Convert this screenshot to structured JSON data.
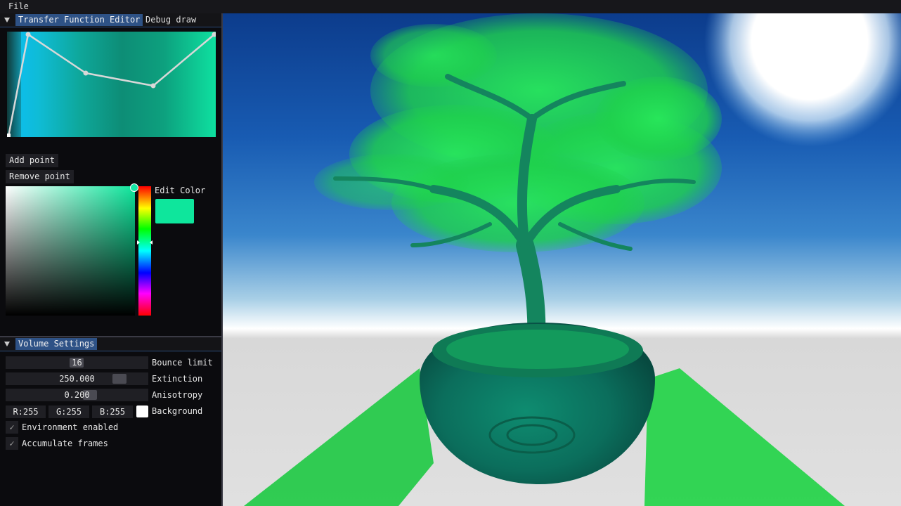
{
  "menubar": {
    "file_label": "File"
  },
  "tabs": [
    {
      "label": "Transfer Function Editor",
      "active": true
    },
    {
      "label": "Debug draw",
      "active": false
    }
  ],
  "transfer_function": {
    "add_point_label": "Add point",
    "remove_point_label": "Remove point"
  },
  "color_picker": {
    "edit_color_label": "Edit Color",
    "current_color": "#0ee69c",
    "hue_color": "#0ee69c"
  },
  "volume_settings": {
    "header": "Volume Settings",
    "bounce_limit": {
      "value": "16",
      "label": "Bounce limit"
    },
    "extinction": {
      "value": "250.000",
      "label": "Extinction"
    },
    "anisotropy": {
      "value": "0.200",
      "label": "Anisotropy"
    },
    "background": {
      "r": "R:255",
      "g": "G:255",
      "b": "B:255",
      "label": "Background",
      "color": "#ffffff"
    },
    "environment_enabled": {
      "label": "Environment enabled",
      "checked": true
    },
    "accumulate_frames": {
      "label": "Accumulate frames",
      "checked": true
    }
  },
  "viewport": {
    "subject": "bonsai-volume-render"
  },
  "colors": {
    "accent": "#2e5286",
    "panel_bg": "#0b0b0e",
    "frame_bg": "#1f1f24",
    "tree_green": "#19e04a",
    "pot_teal": "#0b8f6a"
  }
}
